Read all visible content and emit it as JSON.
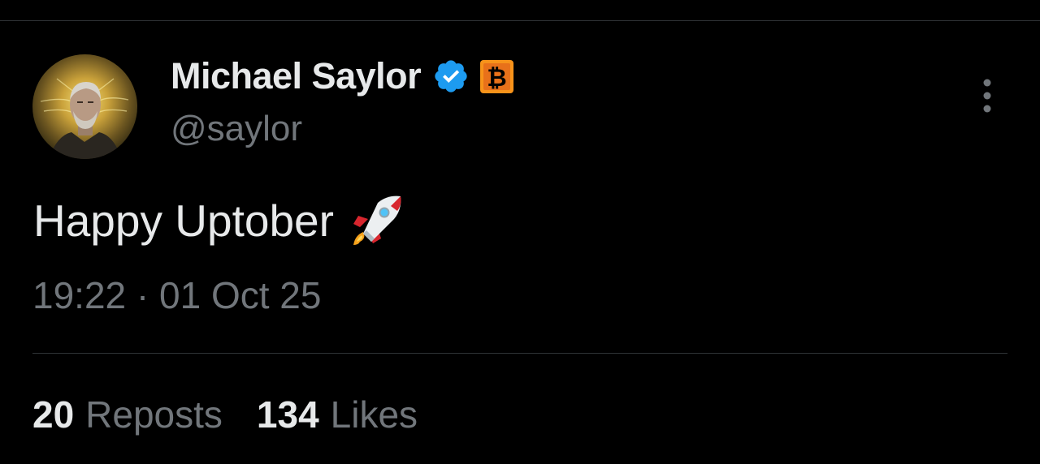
{
  "tweet": {
    "author": {
      "display_name": "Michael Saylor",
      "handle": "@saylor",
      "avatar_icon": "profile-photo",
      "verified_icon": "verified-badge-icon",
      "affiliate_icon": "bitcoin-badge-icon"
    },
    "text": "Happy Uptober",
    "emoji": "rocket",
    "timestamp": "19:22 · 01 Oct 25",
    "stats": [
      {
        "count": "20",
        "label": "Reposts"
      },
      {
        "count": "134",
        "label": "Likes"
      }
    ],
    "more_icon": "more-options-icon"
  },
  "colors": {
    "background": "#000000",
    "primary_text": "#e7e9ea",
    "secondary_text": "#71767b",
    "divider": "#2f3336",
    "verified_blue": "#1d9bf0",
    "bitcoin_orange": "#f7931a"
  }
}
